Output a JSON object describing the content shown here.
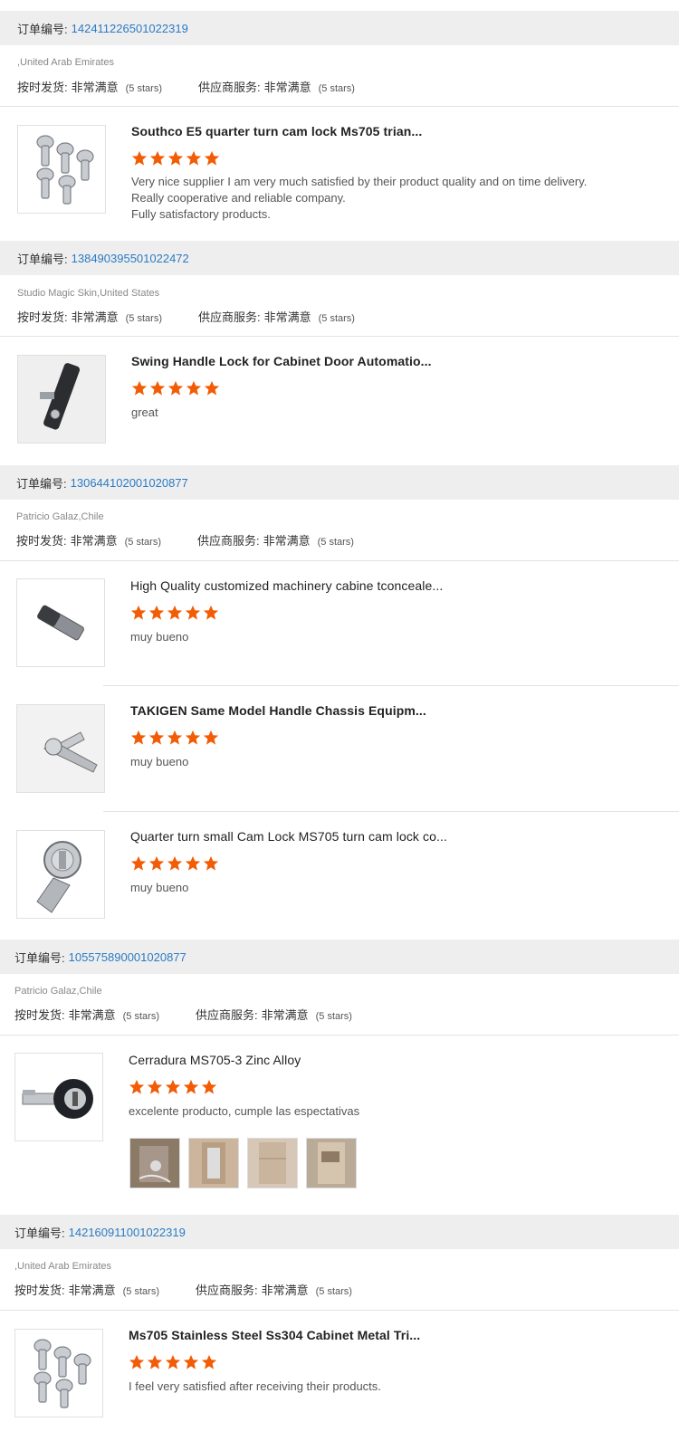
{
  "labels": {
    "order_no": "订单编号:",
    "on_time": "按时发货:",
    "supplier_service": "供应商服务:",
    "very_satisfied": "非常满意",
    "stars_note": "(5 stars)"
  },
  "colors": {
    "accent_link": "#2b7bc4",
    "star": "#f25c05",
    "header_bg": "#eeeeee"
  },
  "orders": [
    {
      "order_number": "142411226501022319",
      "buyer": ",United Arab Emirates",
      "reviews": [
        {
          "title": "Southco E5 quarter turn cam lock Ms705 trian...",
          "rating": 5,
          "comment": [
            "Very nice supplier I am very much satisfied by their product quality and on time delivery.",
            "Really cooperative and reliable company.",
            "Fully satisfactory products."
          ],
          "image": "cam-locks-set"
        }
      ]
    },
    {
      "order_number": "138490395501022472",
      "buyer": "Studio Magic Skin,United States",
      "reviews": [
        {
          "title": "Swing Handle Lock for Cabinet Door Automatio...",
          "rating": 5,
          "comment": [
            "great"
          ],
          "image": "swing-handle"
        }
      ]
    },
    {
      "order_number": "130644102001020877",
      "buyer": "Patricio Galaz,Chile",
      "reviews": [
        {
          "title": "High Quality customized machinery cabine tconceale...",
          "rating": 5,
          "comment": [
            "muy bueno"
          ],
          "image": "concealed-hinge"
        },
        {
          "title": "TAKIGEN Same Model Handle Chassis Equipm...",
          "rating": 5,
          "comment": [
            "muy bueno"
          ],
          "image": "wing-knob"
        },
        {
          "title": "Quarter turn small Cam Lock MS705 turn cam lock co...",
          "rating": 5,
          "comment": [
            "muy bueno"
          ],
          "image": "cam-lock"
        }
      ]
    },
    {
      "order_number": "105575890001020877",
      "buyer": "Patricio Galaz,Chile",
      "reviews": [
        {
          "title": "Cerradura MS705-3 Zinc Alloy",
          "rating": 5,
          "comment": [
            "excelente producto, cumple las espectativas"
          ],
          "image": "black-cam-lock",
          "photos": [
            "buyer-photo-1",
            "buyer-photo-2",
            "buyer-photo-3",
            "buyer-photo-4"
          ]
        }
      ]
    },
    {
      "order_number": "142160911001022319",
      "buyer": ",United Arab Emirates",
      "reviews": [
        {
          "title": "Ms705 Stainless Steel Ss304 Cabinet Metal Tri...",
          "rating": 5,
          "comment": [
            "I feel very satisfied after receiving their products."
          ],
          "image": "cam-locks-set"
        }
      ]
    }
  ]
}
